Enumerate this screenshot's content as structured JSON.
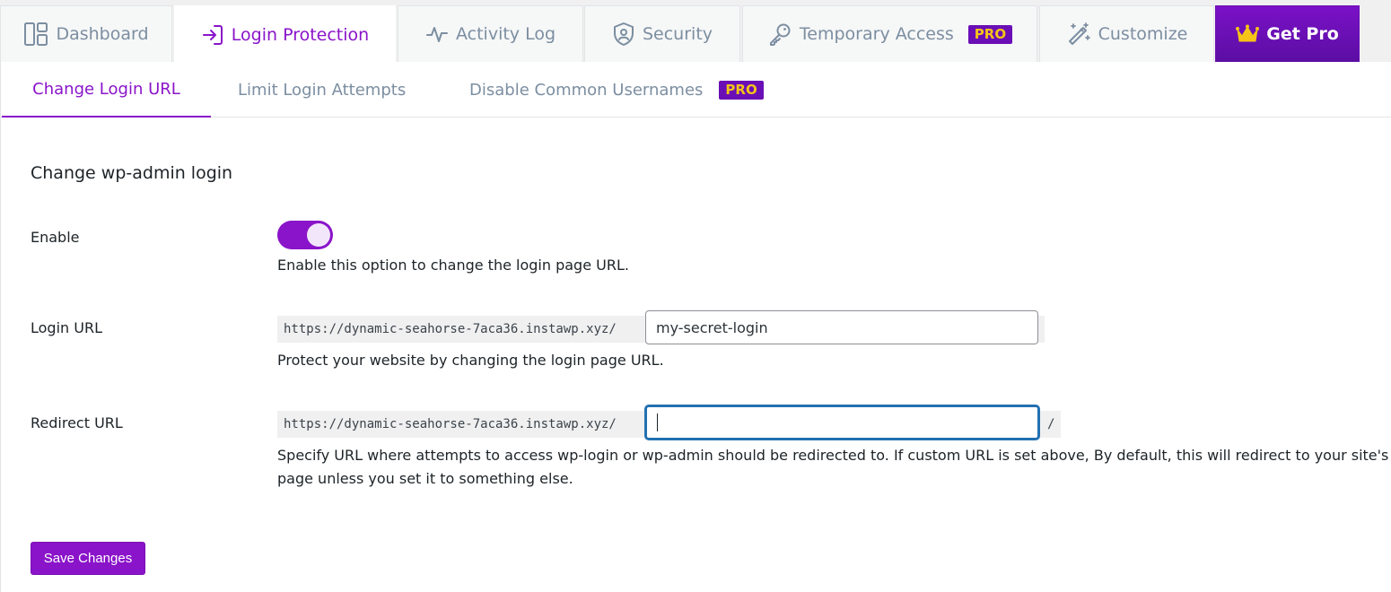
{
  "top_tabs": {
    "dashboard": "Dashboard",
    "login_protection": "Login Protection",
    "activity_log": "Activity Log",
    "security": "Security",
    "temporary_access": "Temporary Access",
    "temporary_access_badge": "PRO",
    "customize": "Customize",
    "get_pro": "Get Pro",
    "active": "Login Protection"
  },
  "sub_tabs": {
    "change_login_url": "Change Login URL",
    "limit_login_attempts": "Limit Login Attempts",
    "disable_common_usernames": "Disable Common Usernames",
    "disable_common_usernames_badge": "PRO",
    "active": "Change Login URL"
  },
  "section": {
    "title": "Change wp-admin login"
  },
  "fields": {
    "enable": {
      "label": "Enable",
      "value": true,
      "description": "Enable this option to change the login page URL."
    },
    "login_url": {
      "label": "Login URL",
      "prefix": "https://dynamic-seahorse-7aca36.instawp.xyz/",
      "value": "my-secret-login",
      "description": "Protect your website by changing the login page URL."
    },
    "redirect_url": {
      "label": "Redirect URL",
      "prefix": "https://dynamic-seahorse-7aca36.instawp.xyz/",
      "value": "",
      "suffix": "/",
      "description": "Specify URL where attempts to access wp-login or wp-admin should be redirected to. If custom URL is set above, By default, this will redirect to your site's H",
      "description_line2": "page unless you set it to something else."
    }
  },
  "actions": {
    "save": "Save Changes"
  },
  "colors": {
    "accent": "#8a14c9",
    "pro_badge_bg": "#6a0fb5",
    "pro_badge_text": "#f5c418",
    "inactive_tab_text": "#7c8ea1",
    "focus_border": "#2271b1"
  },
  "icons": {
    "dashboard": "dashboard-grid-icon",
    "login_protection": "login-arrow-icon",
    "activity_log": "pulse-icon",
    "security": "shield-user-icon",
    "temporary_access": "key-icon",
    "customize": "magic-wand-icon",
    "get_pro": "crown-icon"
  }
}
